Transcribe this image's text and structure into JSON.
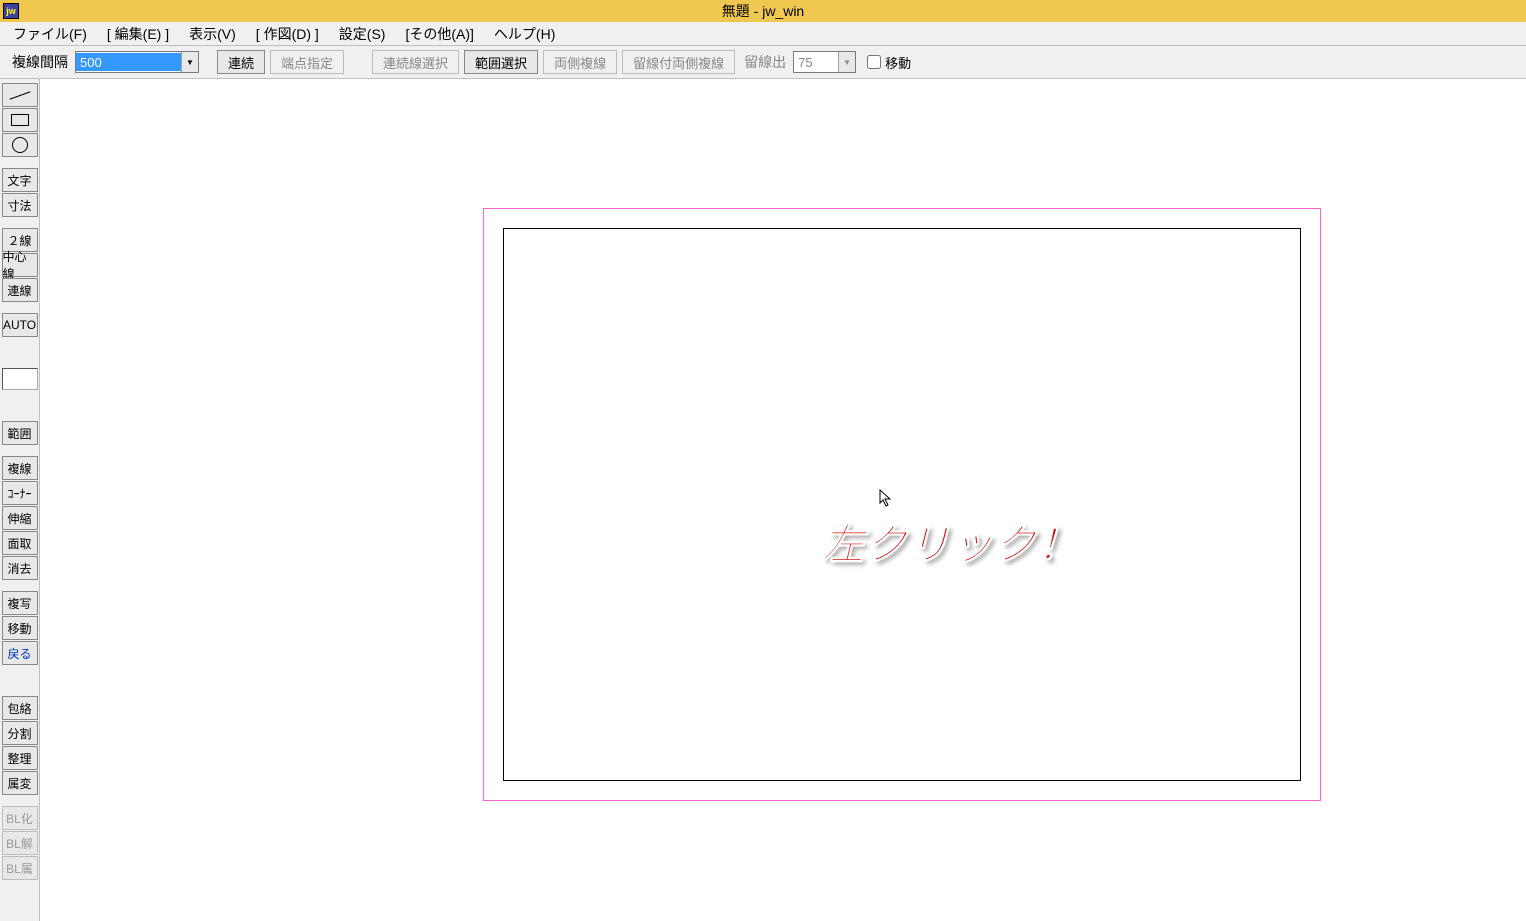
{
  "window": {
    "title": "無題 - jw_win",
    "app_icon_text": "jw"
  },
  "menubar": {
    "items": [
      "ファイル(F)",
      "[ 編集(E) ]",
      "表示(V)",
      "[ 作図(D) ]",
      "設定(S)",
      "[その他(A)]",
      "ヘルプ(H)"
    ]
  },
  "toolbar": {
    "spacing_label": "複線間隔",
    "spacing_value": "500",
    "renroku": "連続",
    "tantenshitei": "端点指定",
    "renzokusen_sentaku": "連続線選択",
    "hanisentaku": "範囲選択",
    "ryosokufukusen": "両側複線",
    "tomesentsukiryosokufukusen": "留線付両側複線",
    "tomesende_label": "留線出",
    "tomesende_value": "75",
    "ido_label": "移動"
  },
  "side_toolbar": {
    "moji": "文字",
    "sunpo": "寸法",
    "nisen": "２線",
    "chushinsen": "中心線",
    "rensen": "連線",
    "auto": "AUTO",
    "hani": "範囲",
    "fukusen": "複線",
    "corner": "ｺｰﾅｰ",
    "shinshuku": "伸縮",
    "mentori": "面取",
    "shokyo": "消去",
    "fukusha": "複写",
    "ido": "移動",
    "modoru": "戻る",
    "horaku": "包絡",
    "bunkatsu": "分割",
    "seiri": "整理",
    "zokuhen": "属変",
    "blka": "BL化",
    "blkai": "BL解",
    "blzoku": "BL属"
  },
  "annotation": {
    "text": "左クリック！"
  }
}
